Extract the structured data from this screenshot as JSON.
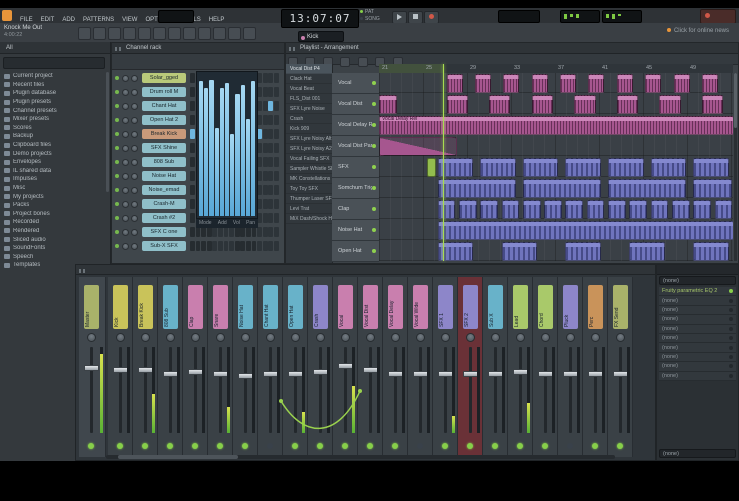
{
  "colors": {
    "accent_orange": "#e8953a",
    "step_blue": "#6fb7e0",
    "clip_pink": "#bd6ca8",
    "clip_purple": "#7277c2",
    "playhead_green": "#a8dc50",
    "led_green": "#87cf4a",
    "selected_strip_red": "#6a3137"
  },
  "menubar": {
    "items": [
      "FILE",
      "EDIT",
      "ADD",
      "PATTERNS",
      "VIEW",
      "OPTIONS",
      "TOOLS",
      "HELP"
    ]
  },
  "transport": {
    "time": "13:07:07",
    "pattern_label": "PAT",
    "song_label": "SONG"
  },
  "toolbar": {
    "project_title": "Knock Me Out",
    "project_time": "4:00:22",
    "pattern_selector": "Kick",
    "news": "Click for online news",
    "icons": [
      "typing-keyboard-icon",
      "metronome-icon",
      "wait-input-icon",
      "countdown-icon",
      "loop-record-icon",
      "step-edit-icon",
      "snap-icon",
      "draw-tool-icon",
      "paint-tool-icon",
      "delete-tool-icon",
      "mute-tool-icon",
      "zoom-tool-icon"
    ]
  },
  "browser": {
    "tab": "All",
    "items": [
      "Current project",
      "Recent files",
      "Plugin database",
      "Plugin presets",
      "Channel presets",
      "Mixer presets",
      "Scores",
      "Backup",
      "Clipboard files",
      "Demo projects",
      "Envelopes",
      "IL shared data",
      "Impulses",
      "Misc",
      "My projects",
      "Packs",
      "Project bones",
      "Recorded",
      "Rendered",
      "Sliced audio",
      "SoundFonts",
      "Speech",
      "Templates"
    ]
  },
  "channel_rack": {
    "title": "Channel rack",
    "channels": [
      {
        "name": "Solar_gged",
        "color": "#b9c97a",
        "steps": []
      },
      {
        "name": "Drum roll M",
        "color": "#8fbfc9",
        "steps": []
      },
      {
        "name": "Chant Hat",
        "color": "#8fbfc9",
        "steps": [
          2,
          6,
          10,
          14
        ]
      },
      {
        "name": "Open Hat 2",
        "color": "#8fbfc9",
        "steps": []
      },
      {
        "name": "Break Kick",
        "color": "#c99a7a",
        "steps": [
          0,
          4,
          8,
          12
        ]
      },
      {
        "name": "SFX Shine",
        "color": "#8fbfc9",
        "steps": []
      },
      {
        "name": "808 Sub",
        "color": "#8fbfc9",
        "steps": []
      },
      {
        "name": "Noise Hat",
        "color": "#8fbfc9",
        "steps": []
      },
      {
        "name": "Noise_emad",
        "color": "#8fbfc9",
        "steps": []
      },
      {
        "name": "Crash-M",
        "color": "#8fbfc9",
        "steps": []
      },
      {
        "name": "Crash #2",
        "color": "#8fbfc9",
        "steps": []
      },
      {
        "name": "SFX C one",
        "color": "#8fbfc9",
        "steps": []
      },
      {
        "name": "Sub-X SFX",
        "color": "#8fbfc9",
        "steps": []
      }
    ],
    "graph_bars": [
      0.95,
      0.9,
      0.96,
      0.62,
      0.9,
      0.94,
      0.58,
      0.86,
      0.92,
      0.68,
      0.95
    ],
    "footer_labels": [
      "Mode",
      "Add",
      "Vol",
      "Pan"
    ]
  },
  "playlist": {
    "title": "Playlist - Arrangement",
    "bar_numbers": [
      "21",
      "25",
      "29",
      "33",
      "37",
      "41",
      "45",
      "49"
    ],
    "playhead_x": 0.18,
    "patterns": [
      "Vocal Dist P4",
      "Clack Hat",
      "Vocal Beat",
      "FLS_Dist 001",
      "SFX Lyre Noise",
      "Crash",
      "Kick 909",
      "SFX Lyre Noisy Alt",
      "SFX Lyre Noisy A2",
      "Vocal Failing SFX",
      "Sampler Whistle SFX",
      "MK Constellations St",
      "Toy Toy SFX",
      "Thumper Laser SFX",
      "Levi Trat",
      "MiX Dash/Shock Hello"
    ],
    "tracks": [
      "Vocal",
      "Vocal Dist",
      "Vocal Delay Rel",
      "Vocal Dist Pan",
      "SFX",
      "Somchum Trigger",
      "Clap",
      "Noise Hat",
      "Open Hat"
    ],
    "clips": [
      {
        "t": 0,
        "x": 0.19,
        "w": 0.045,
        "c": "pink"
      },
      {
        "t": 0,
        "x": 0.27,
        "w": 0.045,
        "c": "pink"
      },
      {
        "t": 0,
        "x": 0.35,
        "w": 0.045,
        "c": "pink"
      },
      {
        "t": 0,
        "x": 0.43,
        "w": 0.045,
        "c": "pink"
      },
      {
        "t": 0,
        "x": 0.51,
        "w": 0.045,
        "c": "pink"
      },
      {
        "t": 0,
        "x": 0.59,
        "w": 0.045,
        "c": "pink"
      },
      {
        "t": 0,
        "x": 0.67,
        "w": 0.045,
        "c": "pink"
      },
      {
        "t": 0,
        "x": 0.75,
        "w": 0.045,
        "c": "pink"
      },
      {
        "t": 0,
        "x": 0.83,
        "w": 0.045,
        "c": "pink"
      },
      {
        "t": 0,
        "x": 0.91,
        "w": 0.045,
        "c": "pink"
      },
      {
        "t": 1,
        "x": 0.0,
        "w": 0.05,
        "c": "pink"
      },
      {
        "t": 1,
        "x": 0.19,
        "w": 0.06,
        "c": "pink"
      },
      {
        "t": 1,
        "x": 0.31,
        "w": 0.06,
        "c": "pink"
      },
      {
        "t": 1,
        "x": 0.43,
        "w": 0.06,
        "c": "pink"
      },
      {
        "t": 1,
        "x": 0.55,
        "w": 0.06,
        "c": "pink"
      },
      {
        "t": 1,
        "x": 0.67,
        "w": 0.06,
        "c": "pink"
      },
      {
        "t": 1,
        "x": 0.79,
        "w": 0.06,
        "c": "pink"
      },
      {
        "t": 1,
        "x": 0.91,
        "w": 0.06,
        "c": "pink"
      },
      {
        "t": 2,
        "x": 0.0,
        "w": 1.0,
        "c": "pink",
        "label": "Vocal Delay Rel"
      },
      {
        "t": 3,
        "x": 0.0,
        "w": 0.22,
        "c": "pinkauto"
      },
      {
        "t": 4,
        "x": 0.135,
        "w": 0.025,
        "c": "green"
      },
      {
        "t": 4,
        "x": 0.165,
        "w": 0.1,
        "c": "purple"
      },
      {
        "t": 4,
        "x": 0.285,
        "w": 0.1,
        "c": "purple"
      },
      {
        "t": 4,
        "x": 0.405,
        "w": 0.1,
        "c": "purple"
      },
      {
        "t": 4,
        "x": 0.525,
        "w": 0.1,
        "c": "purple"
      },
      {
        "t": 4,
        "x": 0.645,
        "w": 0.1,
        "c": "purple"
      },
      {
        "t": 4,
        "x": 0.765,
        "w": 0.1,
        "c": "purple"
      },
      {
        "t": 4,
        "x": 0.885,
        "w": 0.1,
        "c": "purple"
      },
      {
        "t": 5,
        "x": 0.165,
        "w": 0.22,
        "c": "purple"
      },
      {
        "t": 5,
        "x": 0.405,
        "w": 0.22,
        "c": "purple"
      },
      {
        "t": 5,
        "x": 0.645,
        "w": 0.22,
        "c": "purple"
      },
      {
        "t": 5,
        "x": 0.885,
        "w": 0.11,
        "c": "purple"
      },
      {
        "t": 6,
        "x": 0.165,
        "w": 0.05,
        "c": "purple"
      },
      {
        "t": 6,
        "x": 0.225,
        "w": 0.05,
        "c": "purple"
      },
      {
        "t": 6,
        "x": 0.285,
        "w": 0.05,
        "c": "purple"
      },
      {
        "t": 6,
        "x": 0.345,
        "w": 0.05,
        "c": "purple"
      },
      {
        "t": 6,
        "x": 0.405,
        "w": 0.05,
        "c": "purple"
      },
      {
        "t": 6,
        "x": 0.465,
        "w": 0.05,
        "c": "purple"
      },
      {
        "t": 6,
        "x": 0.525,
        "w": 0.05,
        "c": "purple"
      },
      {
        "t": 6,
        "x": 0.585,
        "w": 0.05,
        "c": "purple"
      },
      {
        "t": 6,
        "x": 0.645,
        "w": 0.05,
        "c": "purple"
      },
      {
        "t": 6,
        "x": 0.705,
        "w": 0.05,
        "c": "purple"
      },
      {
        "t": 6,
        "x": 0.765,
        "w": 0.05,
        "c": "purple"
      },
      {
        "t": 6,
        "x": 0.825,
        "w": 0.05,
        "c": "purple"
      },
      {
        "t": 6,
        "x": 0.885,
        "w": 0.05,
        "c": "purple"
      },
      {
        "t": 6,
        "x": 0.945,
        "w": 0.05,
        "c": "purple"
      },
      {
        "t": 7,
        "x": 0.165,
        "w": 0.835,
        "c": "purple"
      },
      {
        "t": 8,
        "x": 0.165,
        "w": 0.1,
        "c": "purple"
      },
      {
        "t": 8,
        "x": 0.345,
        "w": 0.1,
        "c": "purple"
      },
      {
        "t": 8,
        "x": 0.525,
        "w": 0.1,
        "c": "purple"
      },
      {
        "t": 8,
        "x": 0.705,
        "w": 0.1,
        "c": "purple"
      },
      {
        "t": 8,
        "x": 0.885,
        "w": 0.1,
        "c": "purple"
      }
    ]
  },
  "mixer": {
    "strips": [
      {
        "name": "Master",
        "color": "#a9b26a",
        "level": 0.78,
        "meter": 0.92,
        "led": true,
        "selected": false
      },
      {
        "name": "Kick",
        "color": "#c9c35a",
        "level": 0.75,
        "meter": 0.0,
        "led": true,
        "selected": false
      },
      {
        "name": "Break Kick",
        "color": "#c9c35a",
        "level": 0.75,
        "meter": 0.45,
        "led": true,
        "selected": false
      },
      {
        "name": "808 Sub",
        "color": "#68b2c9",
        "level": 0.7,
        "meter": 0.0,
        "led": true,
        "selected": false
      },
      {
        "name": "Clap",
        "color": "#c97fae",
        "level": 0.72,
        "meter": 0.0,
        "led": true,
        "selected": false
      },
      {
        "name": "Snare",
        "color": "#c97fae",
        "level": 0.7,
        "meter": 0.3,
        "led": true,
        "selected": false
      },
      {
        "name": "Noise Hat",
        "color": "#68b2c9",
        "level": 0.68,
        "meter": 0.0,
        "led": true,
        "selected": false
      },
      {
        "name": "Chant Hat",
        "color": "#68b2c9",
        "level": 0.7,
        "meter": 0.0,
        "led": false,
        "selected": false
      },
      {
        "name": "Open Hat",
        "color": "#68b2c9",
        "level": 0.7,
        "meter": 0.25,
        "led": true,
        "selected": false
      },
      {
        "name": "Crash",
        "color": "#8d86c9",
        "level": 0.72,
        "meter": 0.0,
        "led": true,
        "selected": false
      },
      {
        "name": "Vocal",
        "color": "#c97fae",
        "level": 0.8,
        "meter": 0.55,
        "led": true,
        "selected": false
      },
      {
        "name": "Vocal Dist",
        "color": "#c97fae",
        "level": 0.75,
        "meter": 0.0,
        "led": true,
        "selected": false
      },
      {
        "name": "Vocal Delay",
        "color": "#c97fae",
        "level": 0.7,
        "meter": 0.0,
        "led": true,
        "selected": false
      },
      {
        "name": "Vocal Wide",
        "color": "#c97fae",
        "level": 0.7,
        "meter": 0.0,
        "led": false,
        "selected": false
      },
      {
        "name": "SFX 1",
        "color": "#8d86c9",
        "level": 0.7,
        "meter": 0.2,
        "led": true,
        "selected": false
      },
      {
        "name": "SFX 2",
        "color": "#8d86c9",
        "level": 0.7,
        "meter": 0.0,
        "led": true,
        "selected": true
      },
      {
        "name": "Sub X",
        "color": "#68b2c9",
        "level": 0.7,
        "meter": 0.0,
        "led": true,
        "selected": false
      },
      {
        "name": "Lead",
        "color": "#a9c96a",
        "level": 0.73,
        "meter": 0.35,
        "led": true,
        "selected": false
      },
      {
        "name": "Chord",
        "color": "#a9c96a",
        "level": 0.7,
        "meter": 0.0,
        "led": true,
        "selected": false
      },
      {
        "name": "Pluck",
        "color": "#8d86c9",
        "level": 0.7,
        "meter": 0.0,
        "led": false,
        "selected": false
      },
      {
        "name": "Perc",
        "color": "#c9935a",
        "level": 0.7,
        "meter": 0.0,
        "led": true,
        "selected": false
      },
      {
        "name": "FX Send",
        "color": "#a9b26a",
        "level": 0.7,
        "meter": 0.0,
        "led": true,
        "selected": false
      }
    ]
  },
  "effects_panel": {
    "input_label": "(none)",
    "output_label": "(none)",
    "slots": [
      "Fruity parametric EQ 2",
      "(none)",
      "(none)",
      "(none)",
      "(none)",
      "(none)",
      "(none)",
      "(none)",
      "(none)",
      "(none)"
    ]
  }
}
